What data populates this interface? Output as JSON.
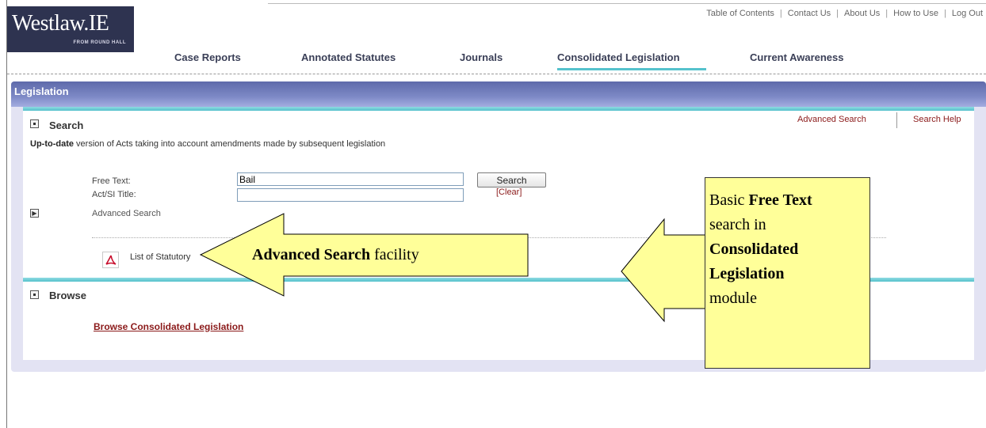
{
  "logo": {
    "main": "Westlaw.IE",
    "sub": "FROM ROUND HALL"
  },
  "toplinks": [
    "Table of Contents",
    "Contact Us",
    "About Us",
    "How to Use",
    "Log Out"
  ],
  "nav": [
    "Case Reports",
    "Annotated Statutes",
    "Journals",
    "Consolidated Legislation",
    "Current Awareness"
  ],
  "panel": {
    "title": "Legislation"
  },
  "search": {
    "title": "Search",
    "advanced_link": "Advanced Search",
    "help_link": "Search Help",
    "subtitle_bold": "Up-to-date",
    "subtitle_rest": " version of Acts taking into account amendments made by subsequent legislation",
    "free_text_label": "Free Text:",
    "free_text_value": "Bail",
    "title_label": "Act/SI Title:",
    "title_value": "",
    "button": "Search",
    "clear": "[Clear]",
    "advanced_label": "Advanced Search",
    "list_label": "List of Statutory"
  },
  "browse": {
    "title": "Browse",
    "link": "Browse Consolidated Legislation"
  },
  "annotations": {
    "left_bold": "Advanced Search",
    "left_rest": " facility",
    "right_line1": "Basic ",
    "right_bold1": "Free Text",
    "right_line2": "search in",
    "right_bold2": "Consolidated",
    "right_bold3": "Legislation",
    "right_line3": "module"
  },
  "colors": {
    "link_red": "#8b1a1a",
    "header_blue": "#6f7bbb",
    "teal": "#55c2cc",
    "callout_yellow": "#ffff99"
  }
}
